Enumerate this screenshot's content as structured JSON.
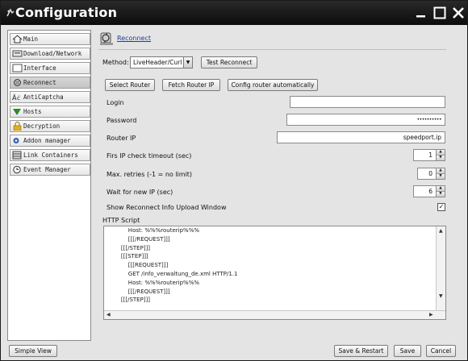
{
  "window": {
    "title": "Configuration"
  },
  "sidebar": {
    "items": [
      {
        "label": "Main",
        "icon": "home-icon"
      },
      {
        "label": "Download/Network",
        "icon": "download-icon"
      },
      {
        "label": "Interface",
        "icon": "window-icon"
      },
      {
        "label": "Reconnect",
        "icon": "reconnect-icon",
        "selected": true
      },
      {
        "label": "AntiCaptcha",
        "icon": "captcha-icon"
      },
      {
        "label": "Hosts",
        "icon": "hosts-triangle-icon"
      },
      {
        "label": "Decryption",
        "icon": "lock-icon"
      },
      {
        "label": "Addon manager",
        "icon": "addon-icon"
      },
      {
        "label": "Link Containers",
        "icon": "container-icon"
      },
      {
        "label": "Event Manager",
        "icon": "clock-icon"
      }
    ]
  },
  "main": {
    "title": "Reconnect",
    "method_label": "Method:",
    "method_value": "LiveHeader/Curl",
    "test_reconnect": "Test Reconnect",
    "select_router": "Select Router",
    "fetch_router_ip": "Fetch Router IP",
    "config_router_auto": "Config router automatically",
    "login_label": "Login",
    "login_value": "",
    "password_label": "Password",
    "password_value": "••••••••••",
    "router_ip_label": "Router IP",
    "router_ip_value": "speedport.ip",
    "first_ip_check_label": "Firs IP check timeout (sec)",
    "first_ip_check_value": "1",
    "max_retries_label": "Max. retries (-1 = no limit)",
    "max_retries_value": "0",
    "wait_new_ip_label": "Wait for new IP (sec)",
    "wait_new_ip_value": "6",
    "show_reconnect_label": "Show Reconnect Info Upload Window",
    "show_reconnect_checked": "✓",
    "http_script_label": "HTTP Script",
    "script_lines": [
      "        Host: %%%routerip%%%",
      "        [[[/REQUEST]]]",
      "    [[[/STEP]]]",
      "",
      "    [[[STEP]]]",
      "        [[[REQUEST]]]",
      "        GET /info_verwaltung_de.xml HTTP/1.1",
      "        Host: %%%routerip%%%",
      "        [[[/REQUEST]]]",
      "    [[[/STEP]]]"
    ]
  },
  "footer": {
    "simple_view": "Simple View",
    "save_restart": "Save & Restart",
    "save": "Save",
    "cancel": "Cancel"
  },
  "colors": {
    "titlebar": "#0c0c0c",
    "panel": "#e4e4e4",
    "link": "#1a3ea0"
  }
}
